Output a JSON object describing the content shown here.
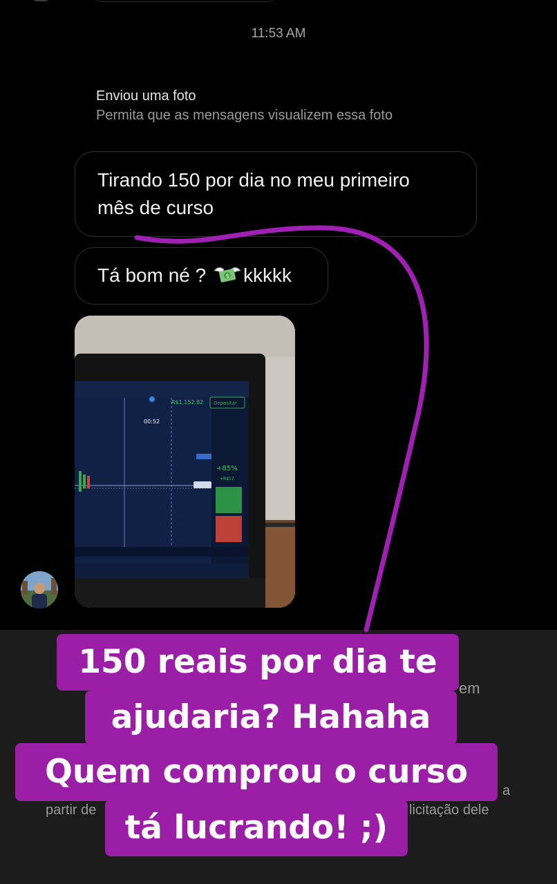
{
  "chat": {
    "timestamp": "11:53 AM",
    "photo_notice": {
      "title": "Enviou uma foto",
      "subtitle": "Permita que as mensagens visualizem essa foto"
    },
    "messages": [
      {
        "text_line1": "Tirando 150 por dia no meu primeiro",
        "text_line2": "mês de curso"
      },
      {
        "text_before": "Tá bom né ? ",
        "emoji": "money-with-wings",
        "text_after": "kkkkk"
      }
    ],
    "photo": {
      "balance": "R$1,152.82",
      "deposit_label": "Depositar",
      "timer": "00:52",
      "percent": "+85%",
      "profit": "+R$17"
    }
  },
  "background_fragments": {
    "right_word": "em",
    "right_letter": "a",
    "bottom_left": "partir de",
    "bottom_right": "licitação dele"
  },
  "caption": {
    "line1": "150 reais por dia te",
    "line2": "ajudaria? Hahaha",
    "line3": "Quem comprou o curso",
    "line4": "tá lucrando! ;)"
  },
  "colors": {
    "caption_bg": "#9a1ea6",
    "annotation_stroke": "#a020b4",
    "bubble_border": "#2e2e2e"
  }
}
